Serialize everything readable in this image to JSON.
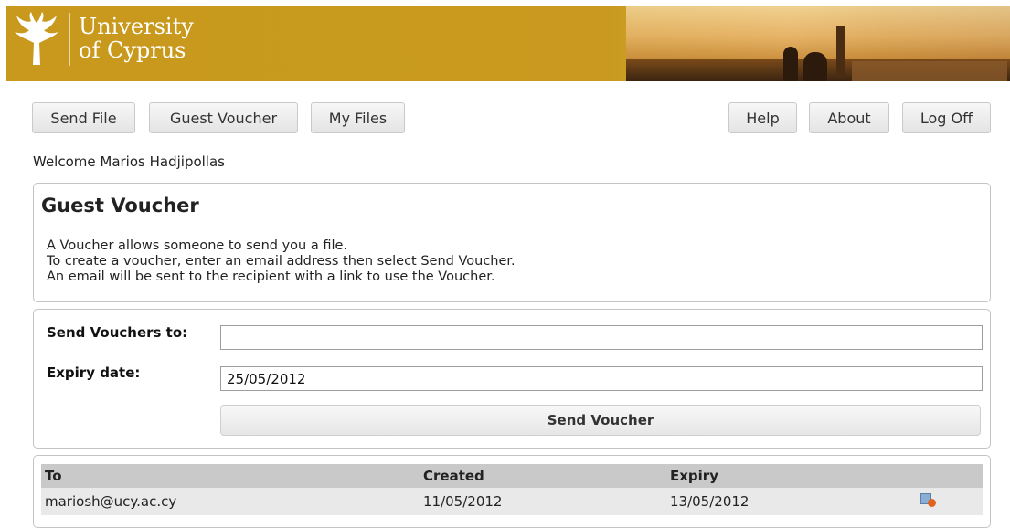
{
  "header": {
    "logo_line1": "University",
    "logo_line2": "of Cyprus"
  },
  "nav": {
    "send_file": "Send File",
    "guest_voucher": "Guest Voucher",
    "my_files": "My Files",
    "help": "Help",
    "about": "About",
    "log_off": "Log Off"
  },
  "welcome": "Welcome Marios Hadjipollas",
  "info_panel": {
    "title": "Guest Voucher",
    "lines": [
      "A Voucher allows someone to send you a file.",
      "To create a voucher, enter an email address then select Send Voucher.",
      "An email will be sent to the recipient with a link to use the Voucher."
    ]
  },
  "form": {
    "send_to_label": "Send Vouchers to:",
    "send_to_value": "",
    "expiry_label": "Expiry date:",
    "expiry_value": "25/05/2012",
    "submit_label": "Send Voucher"
  },
  "table": {
    "headers": [
      "To",
      "Created",
      "Expiry",
      ""
    ],
    "rows": [
      {
        "to": "mariosh@ucy.ac.cy",
        "created": "11/05/2012",
        "expiry": "13/05/2012",
        "action_icon": "delete-voucher-icon"
      }
    ]
  },
  "colors": {
    "banner": "#c8991c",
    "table_header": "#c9c9c9",
    "table_row": "#e9e9e9"
  }
}
